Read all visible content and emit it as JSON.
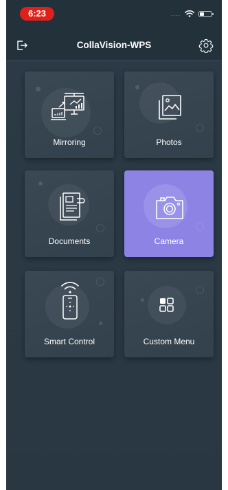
{
  "status_bar": {
    "time": "6:23",
    "signal": "....",
    "time_badge_color": "#e0201a"
  },
  "header": {
    "title": "CollaVision-WPS",
    "left_icon": "logout-icon",
    "right_icon": "gear-icon"
  },
  "tiles": [
    {
      "label": "Mirroring",
      "icon": "screen-mirroring-icon",
      "active": false
    },
    {
      "label": "Photos",
      "icon": "photo-album-icon",
      "active": false
    },
    {
      "label": "Documents",
      "icon": "document-icon",
      "active": false
    },
    {
      "label": "Camera",
      "icon": "camera-icon",
      "active": true
    },
    {
      "label": "Smart Control",
      "icon": "remote-control-icon",
      "active": false
    },
    {
      "label": "Custom Menu",
      "icon": "grid-menu-icon",
      "active": false
    }
  ],
  "colors": {
    "background": "#2a3944",
    "tile": "#37454f",
    "active_tile": "#8d83e5"
  }
}
